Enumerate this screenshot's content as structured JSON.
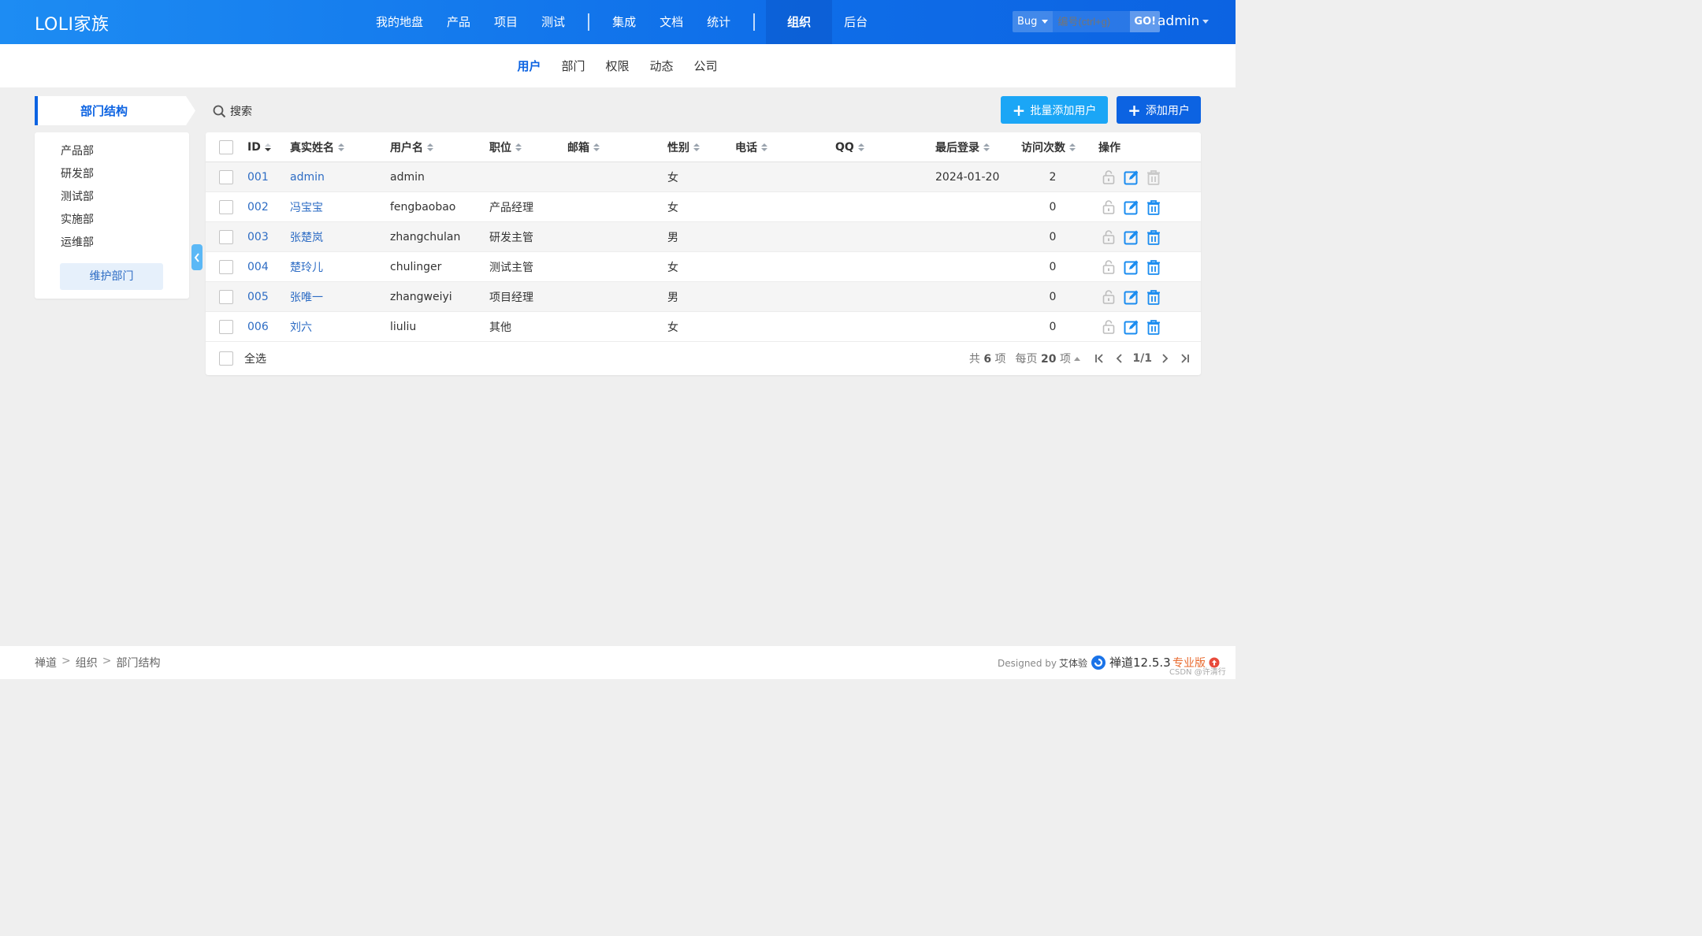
{
  "header": {
    "brand": "LOLI家族",
    "nav": [
      "我的地盘",
      "产品",
      "项目",
      "测试",
      "集成",
      "文档",
      "统计",
      "组织",
      "后台"
    ],
    "active_nav": "组织",
    "search": {
      "type": "Bug",
      "placeholder": "编号(ctrl+g)",
      "go": "GO!"
    },
    "user": "admin"
  },
  "subnav": {
    "items": [
      "用户",
      "部门",
      "权限",
      "动态",
      "公司"
    ],
    "active": "用户"
  },
  "sidebar": {
    "title": "部门结构",
    "departments": [
      "产品部",
      "研发部",
      "测试部",
      "实施部",
      "运维部"
    ],
    "manage_button": "维护部门"
  },
  "toolbar": {
    "search": "搜索",
    "batch_add": "批量添加用户",
    "add": "添加用户"
  },
  "table": {
    "columns": [
      "ID",
      "真实姓名",
      "用户名",
      "职位",
      "邮箱",
      "性别",
      "电话",
      "QQ",
      "最后登录",
      "访问次数",
      "操作"
    ],
    "rows": [
      {
        "id": "001",
        "realname": "admin",
        "account": "admin",
        "role": "",
        "email": "",
        "gender": "女",
        "phone": "",
        "qq": "",
        "last": "2024-01-20",
        "visits": "2"
      },
      {
        "id": "002",
        "realname": "冯宝宝",
        "account": "fengbaobao",
        "role": "产品经理",
        "email": "",
        "gender": "女",
        "phone": "",
        "qq": "",
        "last": "",
        "visits": "0"
      },
      {
        "id": "003",
        "realname": "张楚岚",
        "account": "zhangchulan",
        "role": "研发主管",
        "email": "",
        "gender": "男",
        "phone": "",
        "qq": "",
        "last": "",
        "visits": "0"
      },
      {
        "id": "004",
        "realname": "楚玲儿",
        "account": "chulinger",
        "role": "测试主管",
        "email": "",
        "gender": "女",
        "phone": "",
        "qq": "",
        "last": "",
        "visits": "0"
      },
      {
        "id": "005",
        "realname": "张唯一",
        "account": "zhangweiyi",
        "role": "项目经理",
        "email": "",
        "gender": "男",
        "phone": "",
        "qq": "",
        "last": "",
        "visits": "0"
      },
      {
        "id": "006",
        "realname": "刘六",
        "account": "liuliu",
        "role": "其他",
        "email": "",
        "gender": "女",
        "phone": "",
        "qq": "",
        "last": "",
        "visits": "0"
      }
    ],
    "select_all": "全选",
    "pager": {
      "total_pre": "共",
      "total": "6",
      "total_post": "项",
      "per_pre": "每页",
      "per": "20",
      "per_post": "项",
      "page": "1/1"
    }
  },
  "footer": {
    "breadcrumb": [
      "禅道",
      "组织",
      "部门结构"
    ],
    "designed_by": "Designed by",
    "designer": "艾体验",
    "version": "禅道12.5.3",
    "edition": "专业版",
    "watermark": "CSDN @许清行"
  },
  "colors": {
    "primary": "#0c63e2",
    "accent": "#1ba6f6",
    "link": "#2d6cc4",
    "edition": "#e8692d"
  },
  "icons": [
    "search-icon",
    "plus-icon",
    "lock-icon",
    "edit-icon",
    "delete-icon",
    "chevron-left-icon",
    "first-page-icon",
    "prev-page-icon",
    "next-page-icon",
    "last-page-icon",
    "zentao-logo-icon"
  ]
}
